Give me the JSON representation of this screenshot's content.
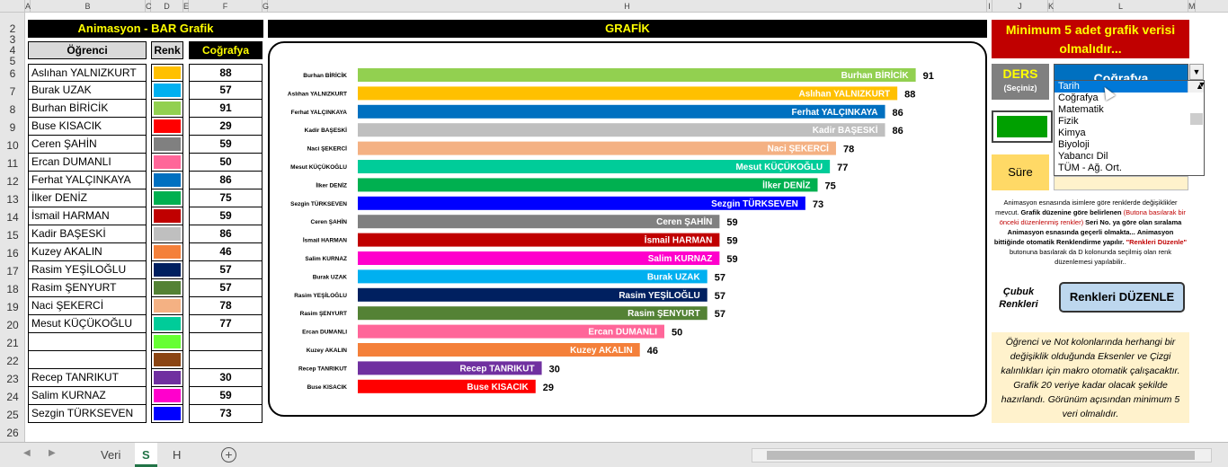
{
  "columns": [
    "A",
    "B",
    "C",
    "D",
    "E",
    "F",
    "G",
    "H",
    "I",
    "J",
    "K",
    "L",
    "M"
  ],
  "rows": [
    "2",
    "3",
    "4",
    "5",
    "6",
    "7",
    "8",
    "9",
    "10",
    "11",
    "12",
    "13",
    "14",
    "15",
    "16",
    "17",
    "18",
    "19",
    "20",
    "21",
    "22",
    "23",
    "24",
    "25",
    "26"
  ],
  "title": "Animasyon - BAR Grafik",
  "chart_header": "GRAFİK",
  "table_headers": {
    "ogrenci": "Öğrenci",
    "renk": "Renk",
    "ders": "Coğrafya"
  },
  "students": [
    {
      "name": "Aslıhan YALNIZKURT",
      "color": "#ffc000",
      "score": "88"
    },
    {
      "name": "Burak UZAK",
      "color": "#00b0f0",
      "score": "57"
    },
    {
      "name": "Burhan BİRİCİK",
      "color": "#92d050",
      "score": "91"
    },
    {
      "name": "Buse KISACIK",
      "color": "#ff0000",
      "score": "29"
    },
    {
      "name": "Ceren ŞAHİN",
      "color": "#808080",
      "score": "59"
    },
    {
      "name": "Ercan DUMANLI",
      "color": "#ff6699",
      "score": "50"
    },
    {
      "name": "Ferhat YALÇINKAYA",
      "color": "#0070c0",
      "score": "86"
    },
    {
      "name": "İlker DENİZ",
      "color": "#00b050",
      "score": "75"
    },
    {
      "name": "İsmail HARMAN",
      "color": "#c00000",
      "score": "59"
    },
    {
      "name": "Kadir BAŞESKİ",
      "color": "#bfbfbf",
      "score": "86"
    },
    {
      "name": "Kuzey AKALIN",
      "color": "#f4803a",
      "score": "46"
    },
    {
      "name": "Rasim YEŞİLOĞLU",
      "color": "#002060",
      "score": "57"
    },
    {
      "name": "Rasim ŞENYURT",
      "color": "#548235",
      "score": "57"
    },
    {
      "name": "Naci ŞEKERCİ",
      "color": "#f4b183",
      "score": "78"
    },
    {
      "name": "Mesut KÜÇÜKOĞLU",
      "color": "#00cc99",
      "score": "77"
    },
    {
      "name": "",
      "color": "#66ff33",
      "score": ""
    },
    {
      "name": "",
      "color": "#8b4513",
      "score": ""
    },
    {
      "name": "Recep TANRIKUT",
      "color": "#7030a0",
      "score": "30"
    },
    {
      "name": "Salim KURNAZ",
      "color": "#ff00cc",
      "score": "59"
    },
    {
      "name": "Sezgin TÜRKSEVEN",
      "color": "#0000ff",
      "score": "73"
    }
  ],
  "chart_data": {
    "type": "bar",
    "categories": [
      "Burhan BİRİCİK",
      "Aslıhan YALNIZKURT",
      "Ferhat YALÇINKAYA",
      "Kadir BAŞESKİ",
      "Naci ŞEKERCİ",
      "Mesut KÜÇÜKOĞLU",
      "İlker DENİZ",
      "Sezgin TÜRKSEVEN",
      "Ceren ŞAHİN",
      "İsmail HARMAN",
      "Salim KURNAZ",
      "Burak UZAK",
      "Rasim YEŞİLOĞLU",
      "Rasim ŞENYURT",
      "Ercan DUMANLI",
      "Kuzey AKALIN",
      "Recep TANRIKUT",
      "Buse KISACIK"
    ],
    "values": [
      91,
      88,
      86,
      86,
      78,
      77,
      75,
      73,
      59,
      59,
      59,
      57,
      57,
      57,
      50,
      46,
      30,
      29
    ],
    "colors": [
      "#92d050",
      "#ffc000",
      "#0070c0",
      "#bfbfbf",
      "#f4b183",
      "#00cc99",
      "#00b050",
      "#0000ff",
      "#808080",
      "#c00000",
      "#ff00cc",
      "#00b0f0",
      "#002060",
      "#548235",
      "#ff6699",
      "#f4803a",
      "#7030a0",
      "#ff0000"
    ],
    "xlim": [
      0,
      100
    ]
  },
  "right": {
    "warning": "Minimum  5 adet grafik verisi olmalıdır...",
    "ders_label": "DERS",
    "ders_sub": "(Seçiniz)",
    "selected": "Coğrafya",
    "options": [
      "Tarih",
      "Coğrafya",
      "Matematik",
      "Fizik",
      "Kimya",
      "Biyoloji",
      "Yabancı Dil",
      "TÜM - Ağ. Ort."
    ],
    "sure_label": "Süre",
    "info_line1": "Animasyon esnasında isimlere göre renklerde değişiklikler mevcut.",
    "info_line2": "Grafik düzenine göre belirlenen",
    "info_line3": "(Butona basılarak bir önceki düzenlenmiş renkler)",
    "info_line4": "Seri No. ya göre olan sıralama Animasyon esnasında geçerli olmakta...",
    "info_line5": "Animasyon bittiğinde otomatik Renklendirme yapılır.",
    "info_line6": "\"Renkleri Düzenle\"",
    "info_line7": "butonuna basılarak da D kolonunda seçilmiş olan renk düzenlemesi yapılabilir..",
    "cubuk_label": "Çubuk Renkleri",
    "btn_label": "Renkleri DÜZENLE",
    "note": "Öğrenci  ve  Not kolonlarında herhangi bir değişiklik olduğunda Eksenler ve Çizgi kalınlıkları için makro otomatik çalışacaktır. Grafik 20 veriye kadar olacak şekilde hazırlandı. Görünüm açısından  minimum 5 veri  olmalıdır."
  },
  "tabs": [
    "Veri",
    "S",
    "H"
  ],
  "add_sheet": "+"
}
